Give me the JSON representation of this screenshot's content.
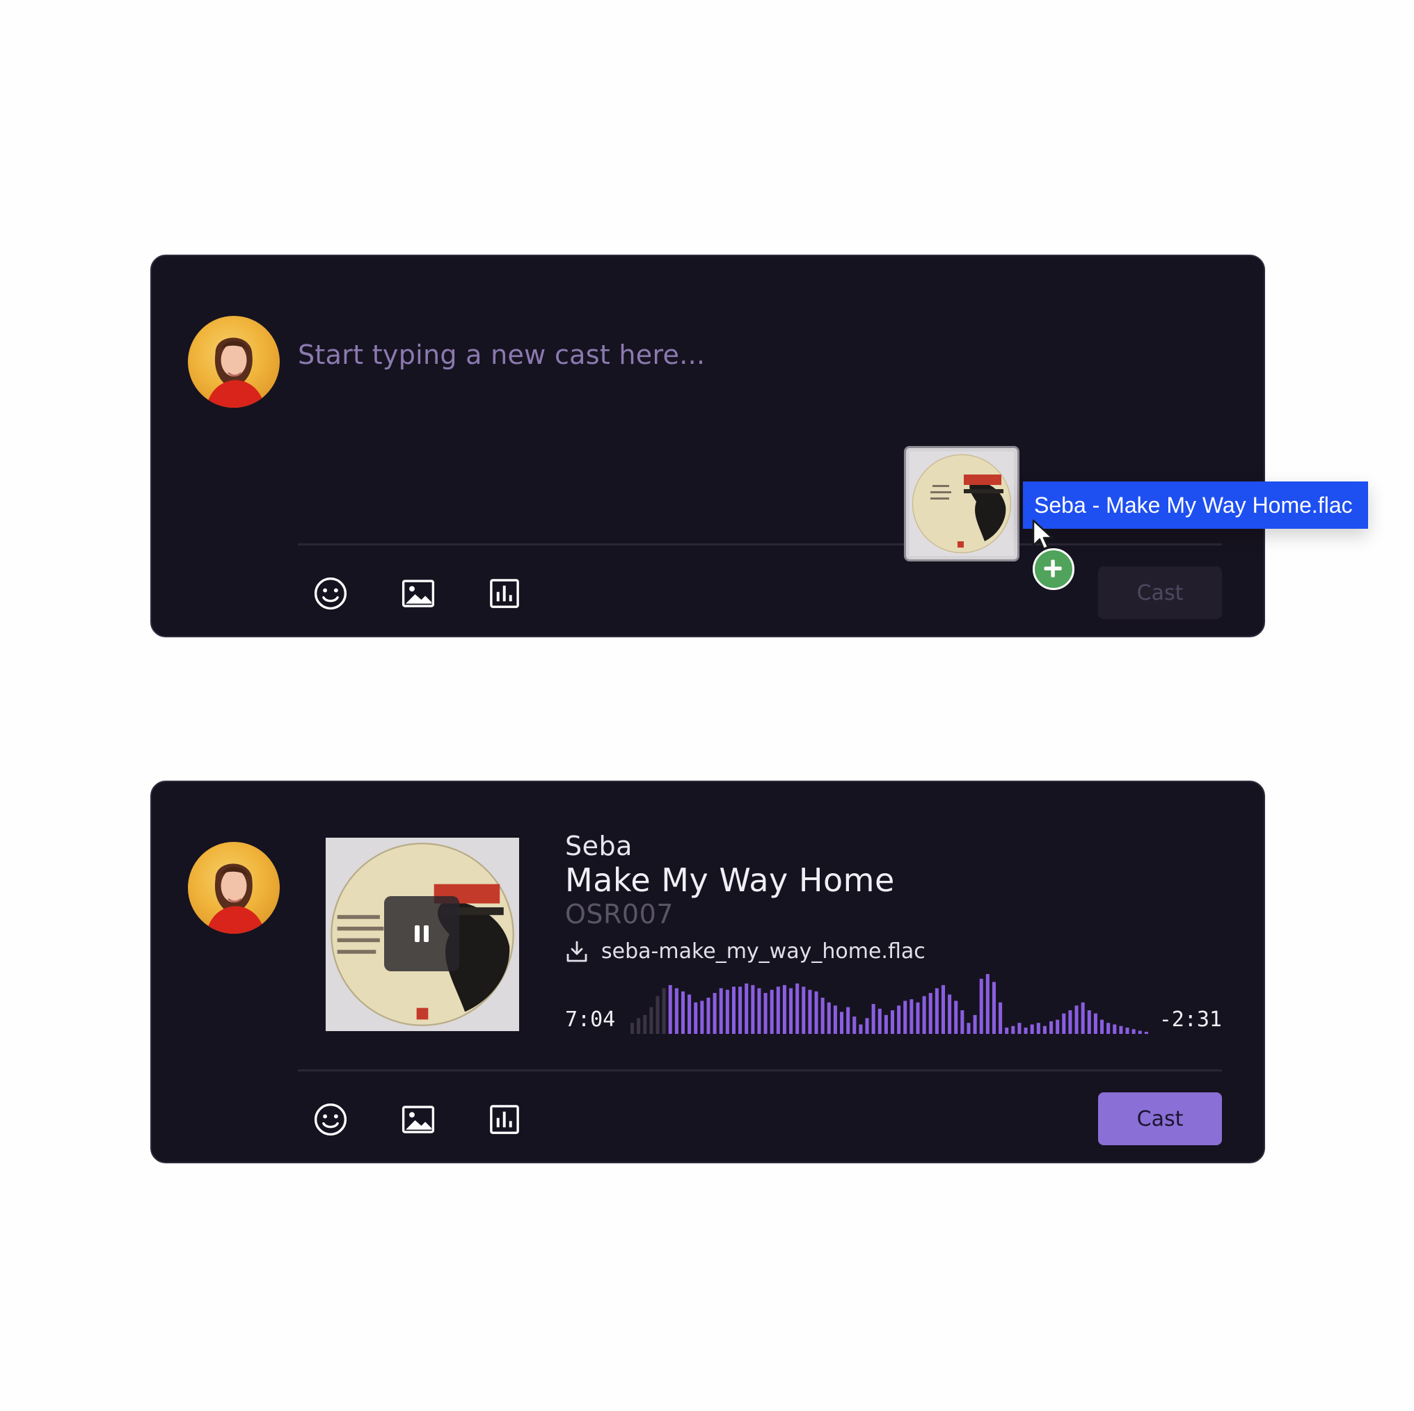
{
  "composer_empty": {
    "placeholder": "Start typing a new cast here...",
    "cast_label": "Cast",
    "cast_enabled": false,
    "toolbar": {
      "icons": [
        "emoji-icon",
        "image-icon",
        "poll-chart-icon"
      ]
    }
  },
  "drag_operation": {
    "file_label": "Seba - Make My Way Home.flac",
    "cursor": "arrow-cursor-icon",
    "badge": "plus-icon",
    "tooltip_color": "#1e4ff0",
    "badge_color": "#4fa35a"
  },
  "composer_attached": {
    "track": {
      "artist": "Seba",
      "title": "Make My Way Home",
      "catalog_code": "OSR007",
      "filename": "seba-make_my_way_home.flac",
      "elapsed": "7:04",
      "remaining": "-2:31",
      "progress_fraction": 0.07,
      "playing": true
    },
    "cast_label": "Cast",
    "cast_enabled": true,
    "toolbar": {
      "icons": [
        "emoji-icon",
        "image-icon",
        "poll-chart-icon"
      ]
    }
  },
  "colors": {
    "card_bg": "#161320",
    "accent": "#8a6fd6",
    "waveform_played": "#3a3344",
    "waveform_unplayed": "#8a5ee0"
  }
}
